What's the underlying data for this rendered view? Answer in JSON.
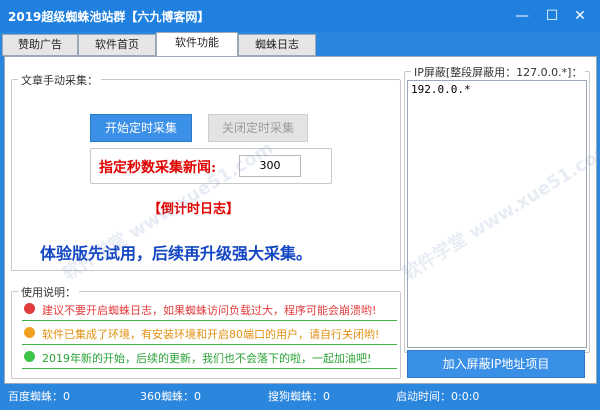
{
  "window": {
    "title": "2019超级蜘蛛池站群【六九博客网】",
    "minimize": "—",
    "maximize": "☐",
    "close": "✕"
  },
  "tabs": [
    {
      "label": "赞助广告"
    },
    {
      "label": "软件首页"
    },
    {
      "label": "软件功能"
    },
    {
      "label": "蜘蛛日志"
    }
  ],
  "collect": {
    "legend": "文章手动采集：",
    "start_btn": "开始定时采集",
    "stop_btn": "关闭定时采集",
    "interval_label": "指定秒数采集新闻:",
    "interval_value": "300",
    "countdown_log": "【倒计时日志】",
    "trial_notice": "体验版先试用，后续再升级强大采集。"
  },
  "usage": {
    "legend": "使用说明：",
    "notes": [
      {
        "text": "建议不要开启蜘蛛日志，如果蜘蛛访问负载过大，程序可能会崩溃哟!",
        "color": "#e23b3b"
      },
      {
        "text": "软件已集成了环境，有安装环境和开启80端口的用户，请自行关闭哟!",
        "color": "#f0a020"
      },
      {
        "text": "2019年新的开始，后续的更新，我们也不会落下的啦，一起加油吧!",
        "color": "#3cc44a"
      }
    ]
  },
  "ip_block": {
    "legend": "IP屏蔽[整段屏蔽用：127.0.0.*]：",
    "content": "192.0.0.*",
    "add_btn": "加入屏蔽IP地址项目"
  },
  "status": {
    "baidu": "百度蜘蛛：0",
    "s360": "360蜘蛛：0",
    "sogou": "搜狗蜘蛛：0",
    "uptime": "启动时间：0:0:0"
  },
  "colors": {
    "title_bg": "#1f80e0",
    "accent": "#3a8fe6",
    "red": "#e00000",
    "blue_text": "#1346c2"
  }
}
